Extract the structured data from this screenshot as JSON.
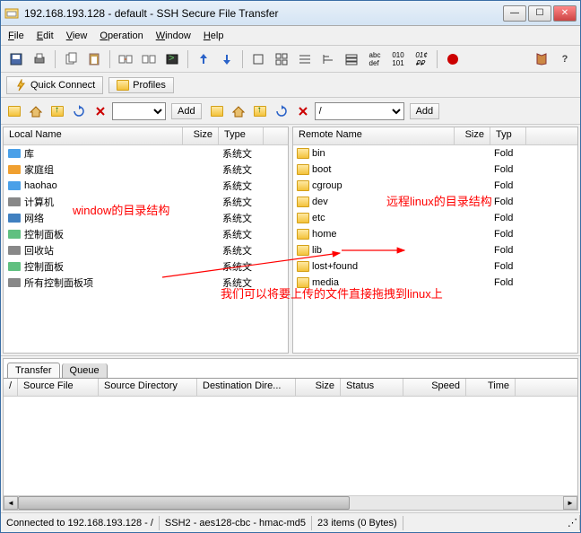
{
  "window": {
    "title": "192.168.193.128 - default - SSH Secure File Transfer"
  },
  "menu": {
    "file": "File",
    "edit": "Edit",
    "view": "View",
    "operation": "Operation",
    "window": "Window",
    "help": "Help"
  },
  "quick": {
    "connect": "Quick Connect",
    "profiles": "Profiles"
  },
  "nav": {
    "add": "Add"
  },
  "local": {
    "cols": {
      "name": "Local Name",
      "size": "Size",
      "type": "Type"
    },
    "items": [
      {
        "name": "库",
        "type": "系统文"
      },
      {
        "name": "家庭组",
        "type": "系统文"
      },
      {
        "name": "haohao",
        "type": "系统文"
      },
      {
        "name": "计算机",
        "type": "系统文"
      },
      {
        "name": "网络",
        "type": "系统文"
      },
      {
        "name": "控制面板",
        "type": "系统文"
      },
      {
        "name": "回收站",
        "type": "系统文"
      },
      {
        "name": "控制面板",
        "type": "系统文"
      },
      {
        "name": "所有控制面板项",
        "type": "系统文"
      }
    ]
  },
  "remote": {
    "cols": {
      "name": "Remote Name",
      "size": "Size",
      "type": "Typ"
    },
    "items": [
      {
        "name": "bin",
        "type": "Fold"
      },
      {
        "name": "boot",
        "type": "Fold"
      },
      {
        "name": "cgroup",
        "type": "Fold"
      },
      {
        "name": "dev",
        "type": "Fold"
      },
      {
        "name": "etc",
        "type": "Fold"
      },
      {
        "name": "home",
        "type": "Fold"
      },
      {
        "name": "lib",
        "type": "Fold"
      },
      {
        "name": "lost+found",
        "type": "Fold"
      },
      {
        "name": "media",
        "type": "Fold"
      }
    ]
  },
  "annot": {
    "left": "window的目录结构",
    "right": "远程linux的目录结构",
    "bottom": "我们可以将要上传的文件直接拖拽到linux上"
  },
  "xfer": {
    "tab1": "Transfer",
    "tab2": "Queue",
    "cols": {
      "slash": "/",
      "src": "Source File",
      "dir": "Source Directory",
      "dest": "Destination Dire...",
      "size": "Size",
      "status": "Status",
      "speed": "Speed",
      "time": "Time"
    }
  },
  "status": {
    "conn": "Connected to 192.168.193.128 - /",
    "cipher": "SSH2 - aes128-cbc - hmac-md5",
    "items": "23 items (0 Bytes)"
  }
}
